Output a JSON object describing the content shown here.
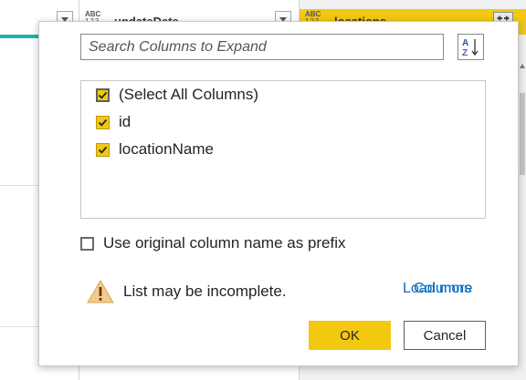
{
  "grid": {
    "col_type_badge": "ABC",
    "col_type_sub": "123",
    "mid_header": "updateDate",
    "right_header": "locations"
  },
  "dialog": {
    "search": {
      "placeholder": "Search Columns to Expand",
      "value": ""
    },
    "sort_icon": "sort-az-icon",
    "columns": [
      {
        "label": "(Select All Columns)",
        "checked": true,
        "kind": "select-all"
      },
      {
        "label": "id",
        "checked": true
      },
      {
        "label": "locationName",
        "checked": true
      }
    ],
    "prefix_option": {
      "label": "Use original column name as prefix",
      "checked": false
    },
    "warning": {
      "icon": "warning-icon",
      "text": "List may be incomplete."
    },
    "links": {
      "load_more": "Load more",
      "columns": "Columns"
    },
    "buttons": {
      "ok": "OK",
      "cancel": "Cancel"
    }
  },
  "colors": {
    "accent": "#f2c811",
    "link": "#0f6cbd",
    "teal_bar": "#1fb3a6"
  }
}
